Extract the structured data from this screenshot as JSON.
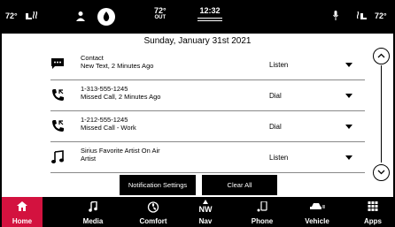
{
  "status": {
    "left_temp": "72°",
    "right_temp": "72°",
    "outside_temp": "72°",
    "outside_label": "OUT",
    "time": "12:32"
  },
  "notifications": {
    "date": "Sunday, January 31st 2021",
    "items": [
      {
        "icon": "message-icon",
        "title": "Contact",
        "subtitle": "New Text, 2 Minutes Ago",
        "action": "Listen"
      },
      {
        "icon": "missed-call-icon",
        "title": "1-313-555-1245",
        "subtitle": "Missed Call, 2 Minutes Ago",
        "action": "Dial"
      },
      {
        "icon": "missed-call-icon",
        "title": "1-212-555-1245",
        "subtitle": "Missed Call - Work",
        "action": "Dial"
      },
      {
        "icon": "music-note-icon",
        "title": "Sirius Favorite Artist On Air",
        "subtitle": "Artist",
        "action": "Listen"
      }
    ],
    "settings_button": "Notification Settings",
    "clear_button": "Clear All"
  },
  "nav": {
    "home": "Home",
    "media": "Media",
    "comfort": "Comfort",
    "nav_direction": "NW",
    "nav": "Nav",
    "phone": "Phone",
    "vehicle": "Vehicle",
    "apps": "Apps"
  },
  "colors": {
    "accent": "#d3123f",
    "background": "#000000",
    "panel": "#ffffff"
  }
}
